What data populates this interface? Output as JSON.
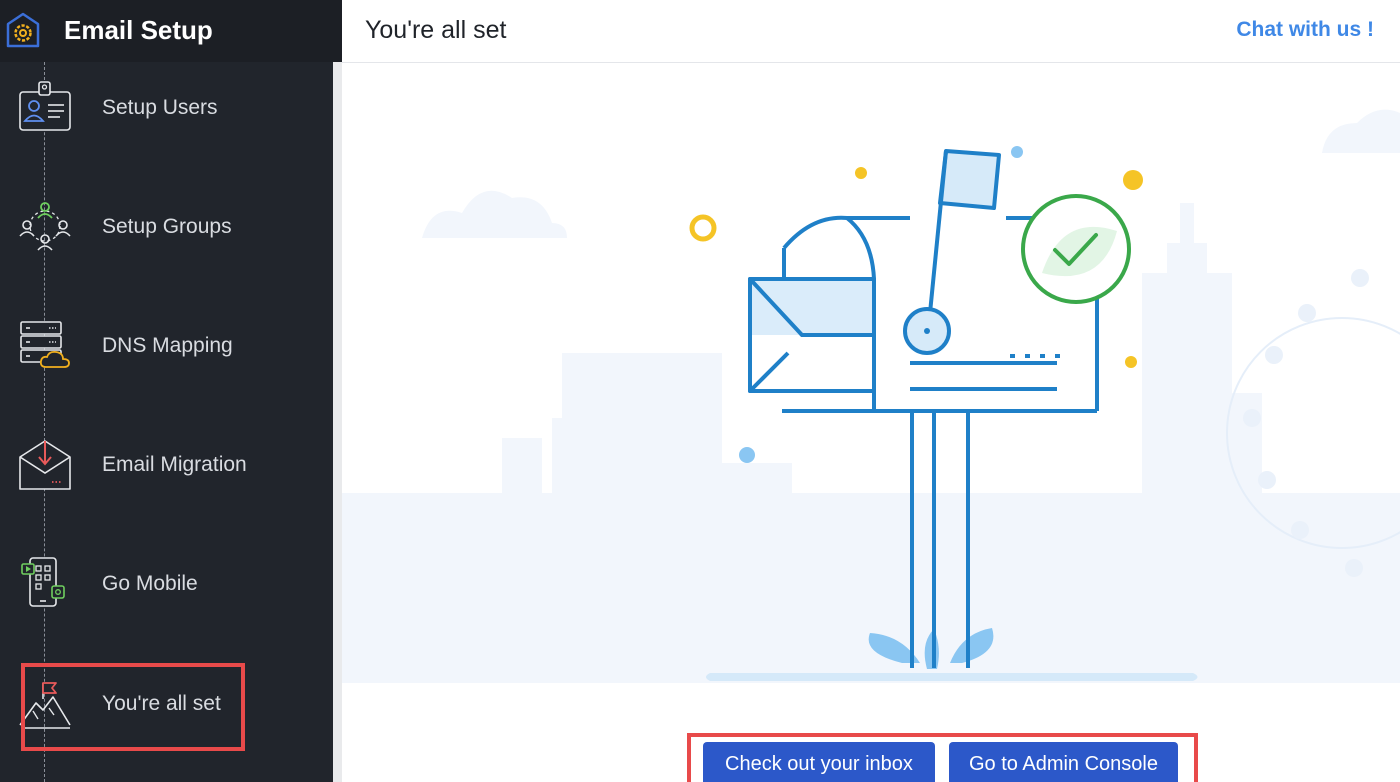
{
  "app": {
    "title": "Email Setup"
  },
  "header": {
    "title": "You're all set",
    "chat_label": "Chat with us !"
  },
  "sidebar": {
    "steps": [
      {
        "label": "Setup Users"
      },
      {
        "label": "Setup Groups"
      },
      {
        "label": "DNS Mapping"
      },
      {
        "label": "Email Migration"
      },
      {
        "label": "Go Mobile"
      },
      {
        "label": "You're all set"
      }
    ],
    "active_step": "You're all set"
  },
  "actions": {
    "inbox_label": "Check out your inbox",
    "admin_label": "Go to Admin Console"
  },
  "colors": {
    "sidebar_bg": "#21252c",
    "accent_blue": "#2c58c9",
    "illustration_blue": "#1f80c8",
    "link_blue": "#3f88e6",
    "highlight_red": "#e84a4a",
    "check_green": "#3aa84a"
  }
}
